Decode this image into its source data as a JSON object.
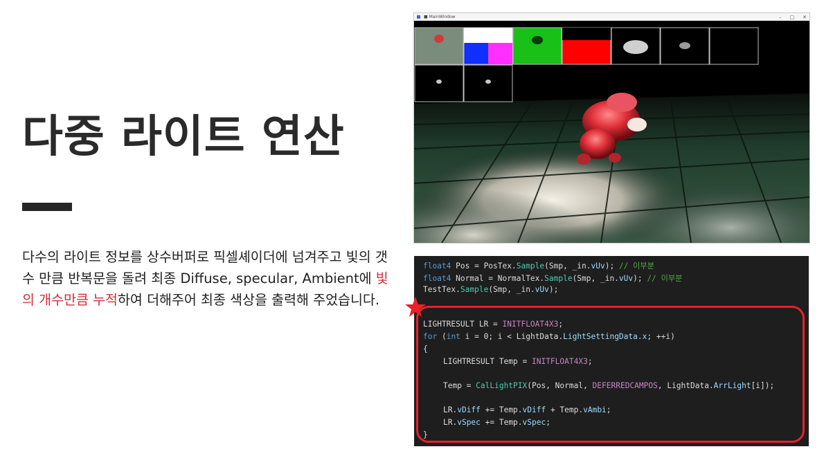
{
  "title": "다중 라이트 연산",
  "description": {
    "before": "다수의 라이트 정보를 상수버퍼로 픽셀셰이더에 넘겨주고 빛의 갯수 만큼 반복문을 돌려 최종 Diffuse, specular, Ambient에  ",
    "highlight": "빛의 개수만큼 누적",
    "after": "하여 더해주어 최종 색상을 출력해 주었습니다."
  },
  "window": {
    "title": "■ MainWindow",
    "controls": [
      "–",
      "□",
      "✕"
    ]
  },
  "code_lines": [
    "float4 Pos = PosTex.Sample(Smp, _in.vUv); // 이부분",
    "float4 Normal = NormalTex.Sample(Smp, _in.vUv); // 이부분",
    "TestTex.Sample(Smp, _in.vUv);",
    "LIGHTRESULT LR = INITFLOAT4X3;",
    "for (int i = 0; i < LightData.LightSettingData.x; ++i)",
    "{",
    "LIGHTRESULT Temp = INITFLOAT4X3;",
    "Temp = CalLightPIX(Pos, Normal, DEFERREDCAMPOS, LightData.ArrLight[i]);",
    "LR.vDiff += Temp.vDiff + Temp.vAmbi;",
    "LR.vSpec += Temp.vSpec;",
    "}"
  ],
  "colors": {
    "highlight": "#d2303c",
    "annotation": "#e8212a",
    "code_bg": "#1e1e1e"
  },
  "icons": [
    "star-icon",
    "window-icon"
  ]
}
